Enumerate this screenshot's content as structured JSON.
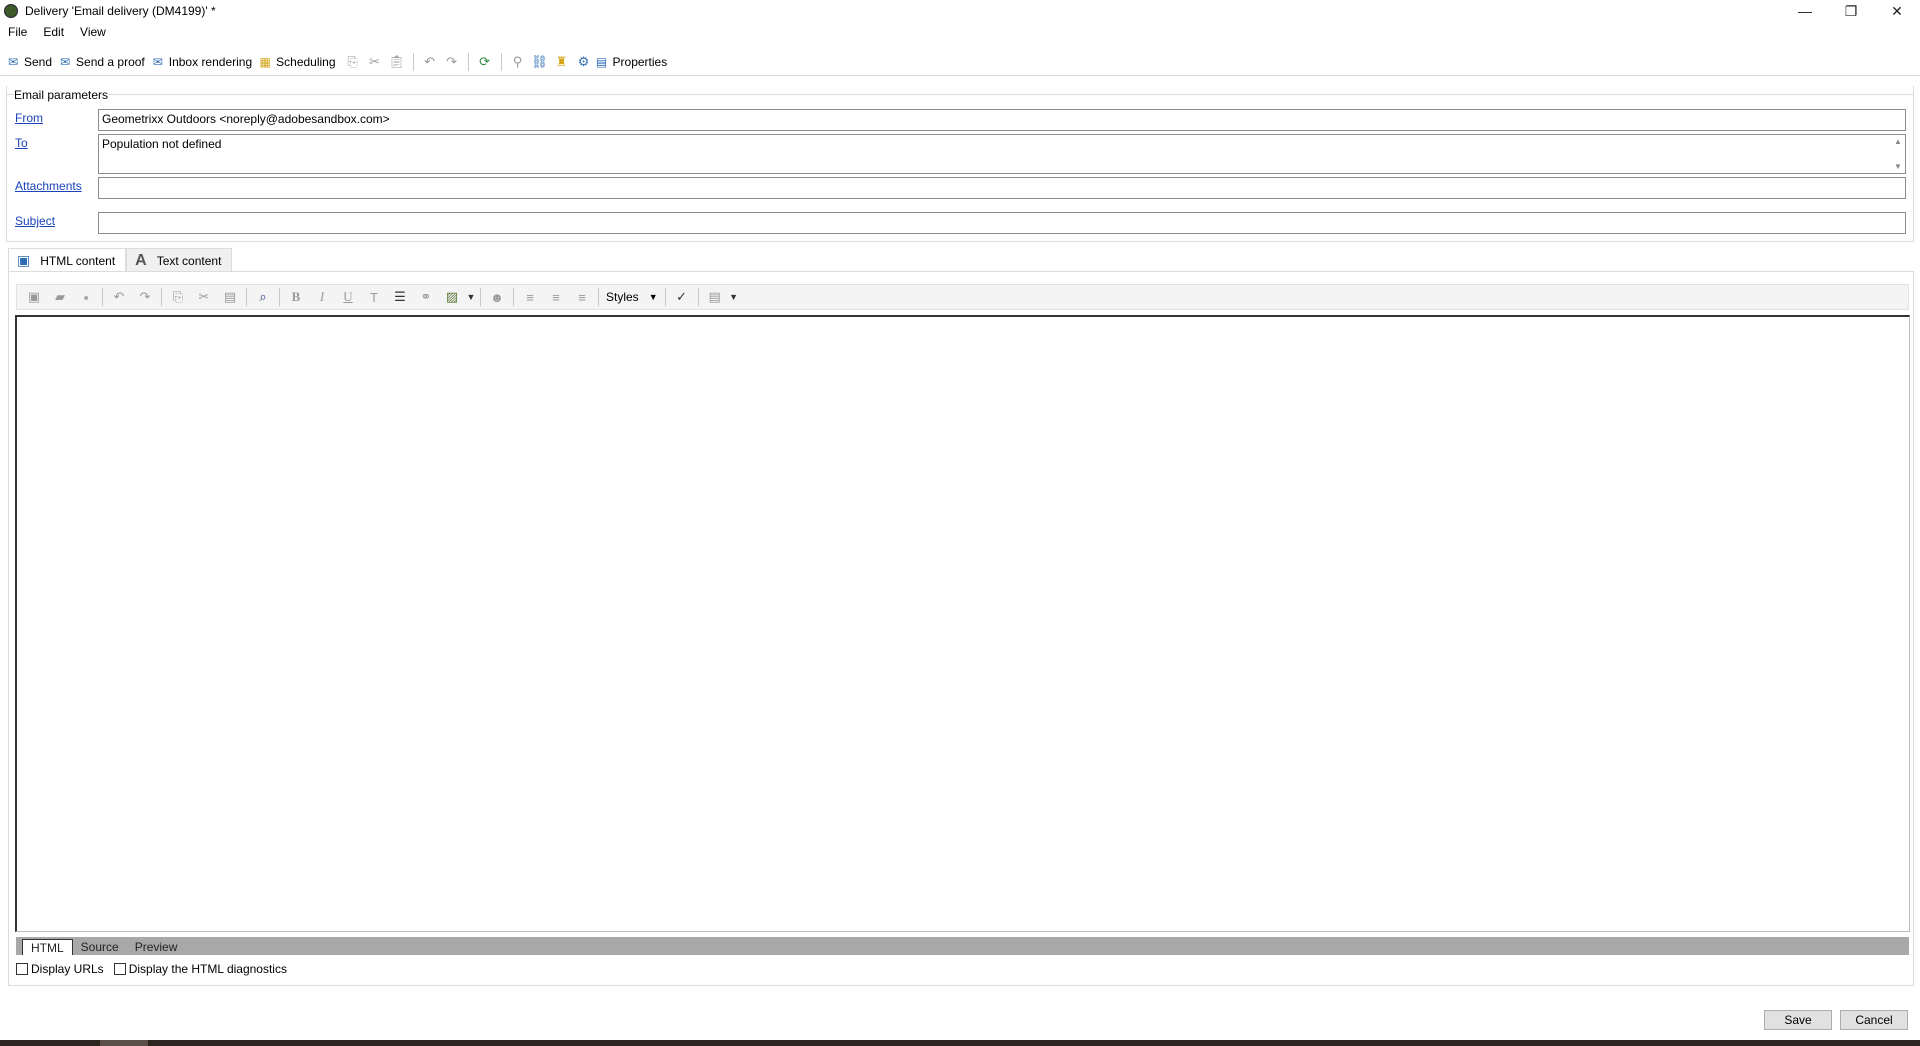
{
  "window": {
    "title": "Delivery 'Email delivery (DM4199)' *",
    "controls": {
      "minimize": "—",
      "restore": "❐",
      "close": "✕"
    }
  },
  "menu": [
    "File",
    "Edit",
    "View"
  ],
  "toolbar": {
    "send": "Send",
    "send_proof": "Send a proof",
    "inbox_rendering": "Inbox rendering",
    "scheduling": "Scheduling",
    "properties": "Properties"
  },
  "email_parameters": {
    "group_title": "Email parameters",
    "from_label": "From",
    "from_value": "Geometrixx Outdoors <noreply@adobesandbox.com>",
    "to_label": "To",
    "to_value": "Population not defined",
    "attachments_label": "Attachments",
    "attachments_value": "",
    "subject_label": "Subject",
    "subject_value": ""
  },
  "content_tabs": [
    {
      "label": "HTML content",
      "active": true
    },
    {
      "label": "Text content",
      "active": false
    }
  ],
  "editor_toolbar": {
    "styles_label": "Styles"
  },
  "editor_view_tabs": [
    {
      "label": "HTML",
      "active": true
    },
    {
      "label": "Source",
      "active": false
    },
    {
      "label": "Preview",
      "active": false
    }
  ],
  "options": {
    "display_urls": {
      "label": "Display URLs",
      "checked": false
    },
    "display_diagnostics": {
      "label": "Display the HTML diagnostics",
      "checked": false
    }
  },
  "footer": {
    "save": "Save",
    "cancel": "Cancel"
  },
  "colors": {
    "link": "#1a44b8",
    "accent_blue": "#2f6db5",
    "gold": "#d3a418",
    "green": "#2e8b3d"
  }
}
